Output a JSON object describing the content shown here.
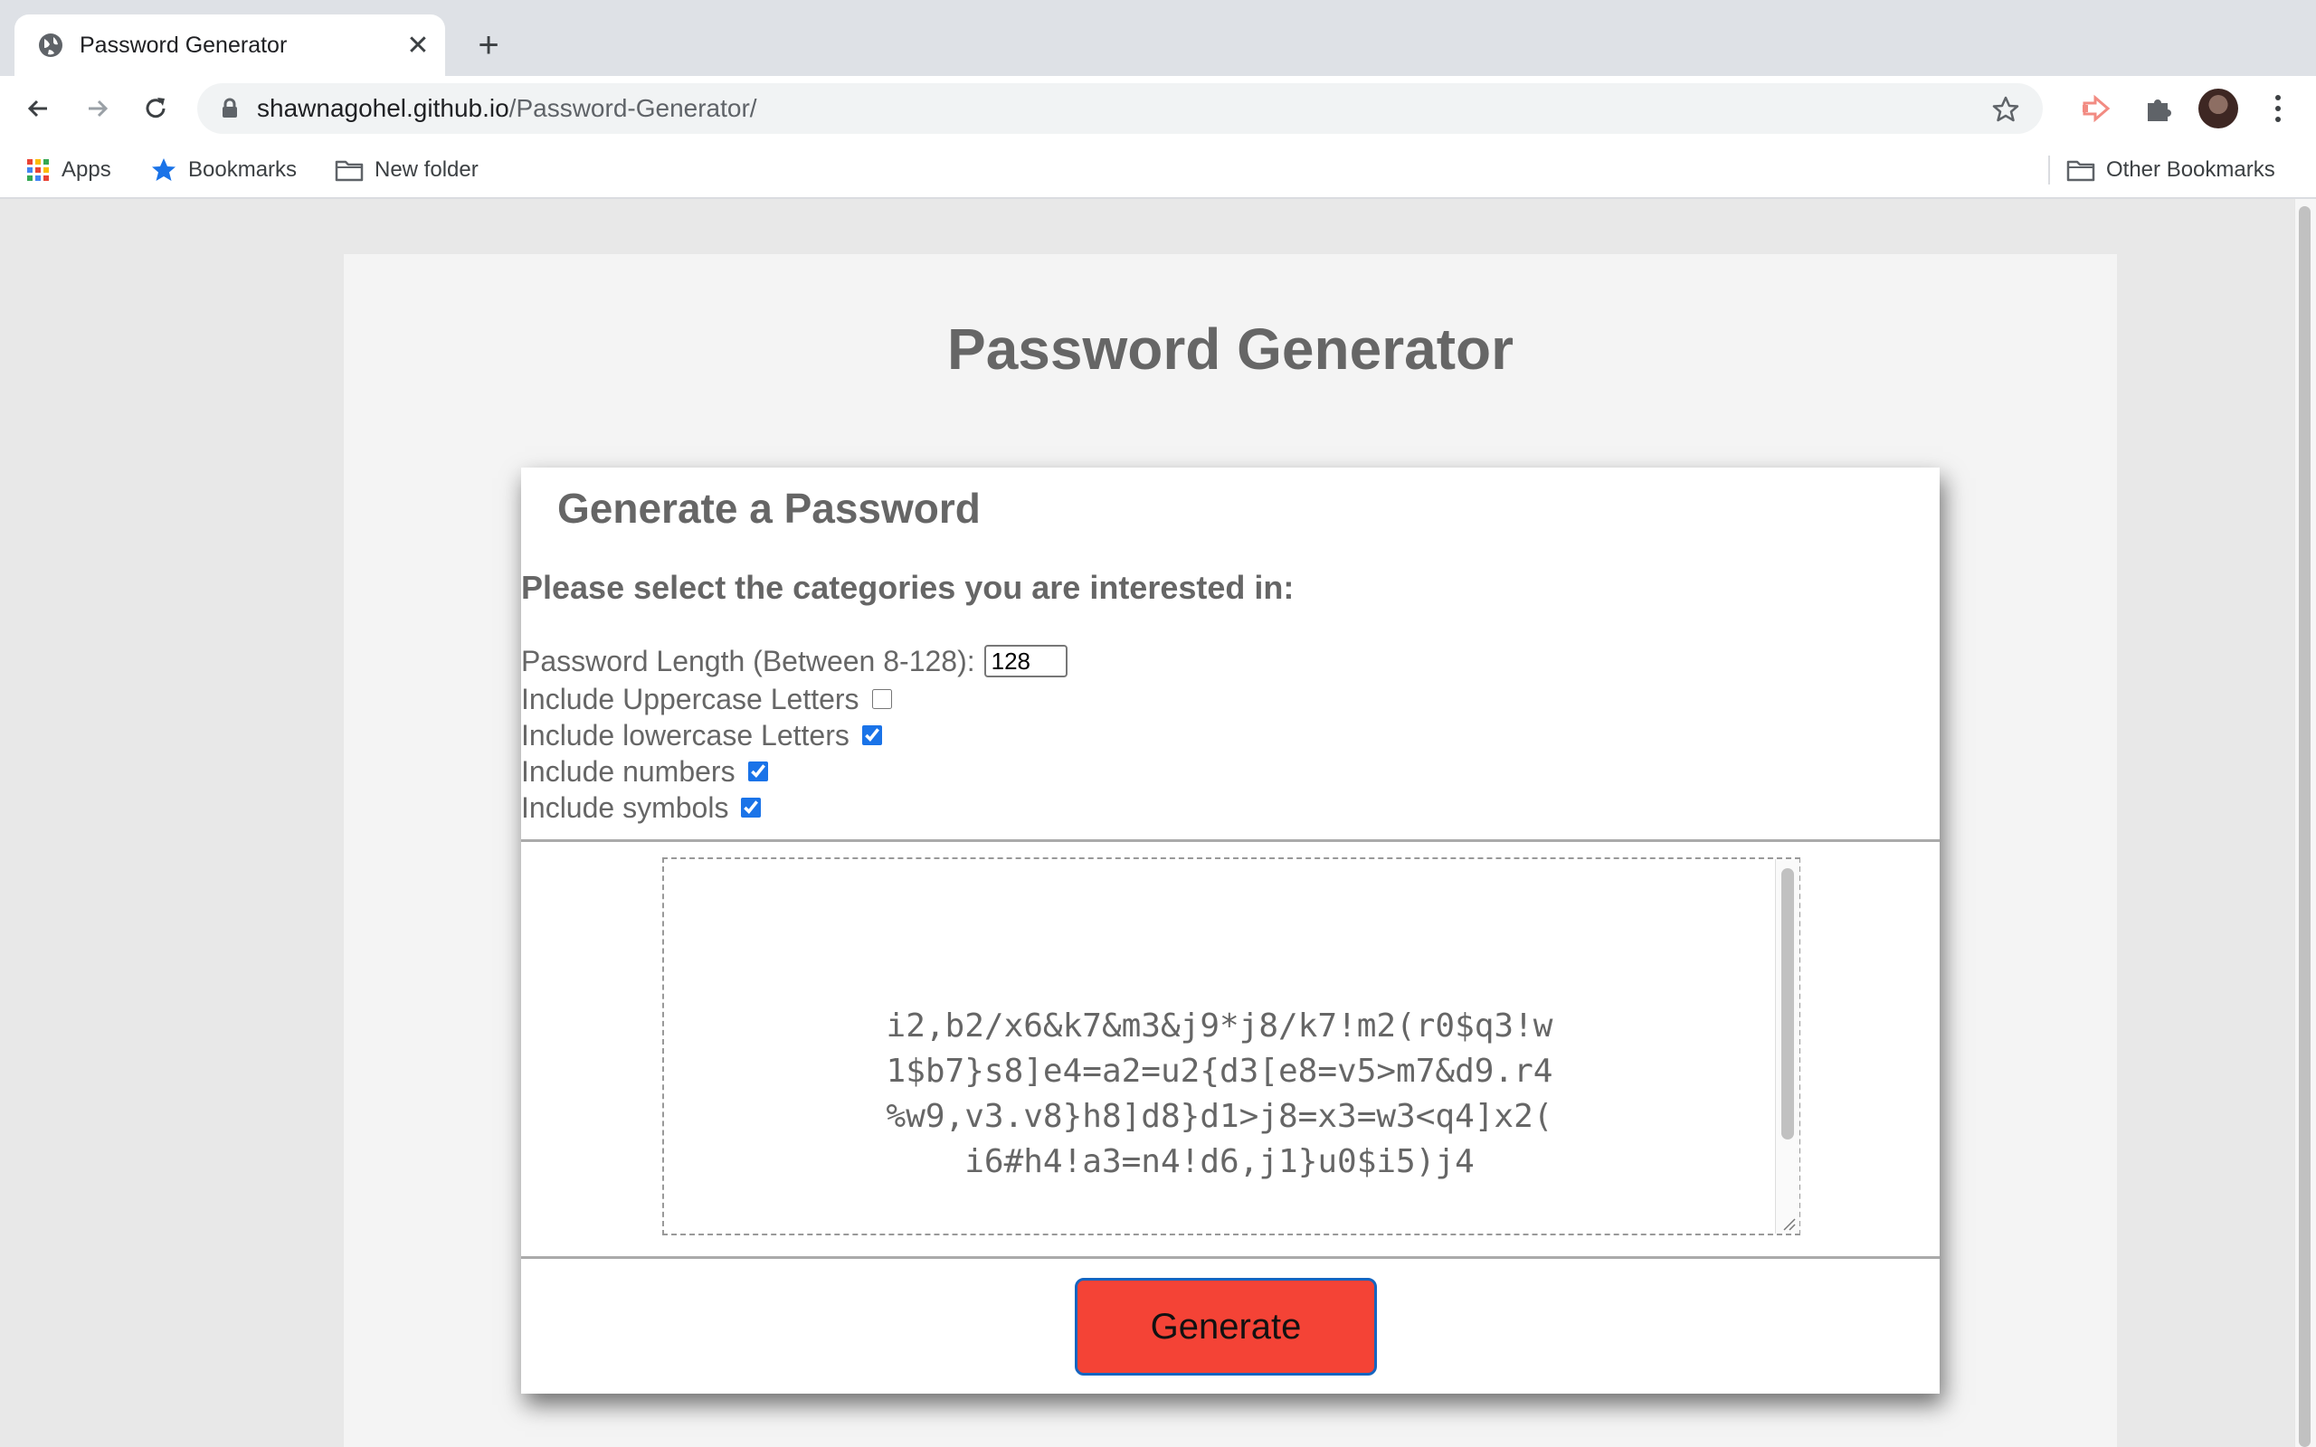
{
  "browser": {
    "tab_title": "Password Generator",
    "url_host": "shawnagohel.github.io",
    "url_path": "/Password-Generator/",
    "bookmarks": [
      {
        "label": "Apps",
        "icon": "apps-grid-icon"
      },
      {
        "label": "Bookmarks",
        "icon": "star-icon"
      },
      {
        "label": "New folder",
        "icon": "folder-icon"
      }
    ],
    "other_bookmarks": "Other Bookmarks"
  },
  "page": {
    "title": "Password Generator",
    "card": {
      "heading": "Generate a Password",
      "instructions": "Please select the categories you are interested in:",
      "length_label": "Password Length (Between 8-128):",
      "length_value": "128",
      "options": [
        {
          "label": "Include Uppercase Letters",
          "checked": false
        },
        {
          "label": "Include lowercase Letters",
          "checked": true
        },
        {
          "label": "Include numbers",
          "checked": true
        },
        {
          "label": "Include symbols",
          "checked": true
        }
      ],
      "password_lines": [
        "i2,b2/x6&k7&m3&j9*j8/k7!m2(r0$q3!w",
        "1$b7}s8]e4=a2=u2{d3[e8=v5>m7&d9.r4",
        "%w9,v3.v8}h8]d8}d1>j8=x3=w3<q4]x2(",
        "i6#h4!a3=n4!d6,j1}u0$i5)j4"
      ],
      "generate_label": "Generate"
    }
  },
  "colors": {
    "button": "#f44336",
    "button_border": "#1565c0",
    "text": "#666666"
  }
}
